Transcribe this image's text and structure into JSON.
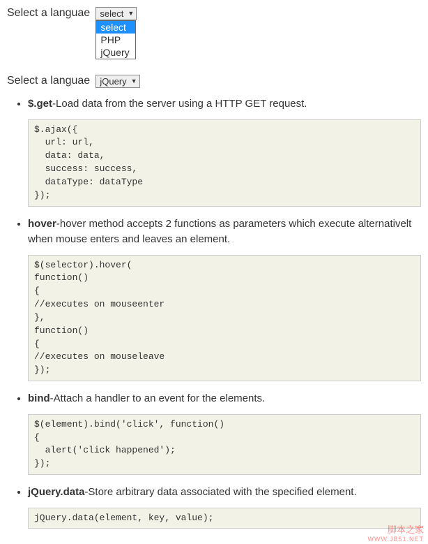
{
  "selector1": {
    "label": "Select a languae",
    "selected": "select",
    "options": [
      "select",
      "PHP",
      "jQuery"
    ]
  },
  "selector2": {
    "label": "Select a languae",
    "selected": "jQuery"
  },
  "topics": [
    {
      "term": "$.get",
      "desc": "-Load data from the server using a HTTP GET request.",
      "code": "$.ajax({\n  url: url,\n  data: data,\n  success: success,\n  dataType: dataType\n});"
    },
    {
      "term": "hover",
      "desc": "-hover method accepts 2 functions as parameters which execute alternativelt when mouse enters and leaves an element.",
      "code": "$(selector).hover(\nfunction()\n{\n//executes on mouseenter\n},\nfunction()\n{\n//executes on mouseleave\n});"
    },
    {
      "term": "bind",
      "desc": "-Attach a handler to an event for the elements.",
      "code": "$(element).bind('click', function()\n{\n  alert('click happened');\n});"
    },
    {
      "term": "jQuery.data",
      "desc": "-Store arbitrary data associated with the specified element.",
      "code": "jQuery.data(element, key, value);"
    }
  ],
  "watermark": {
    "line1": "脚本之家",
    "line2": "WWW.JB51.NET"
  }
}
